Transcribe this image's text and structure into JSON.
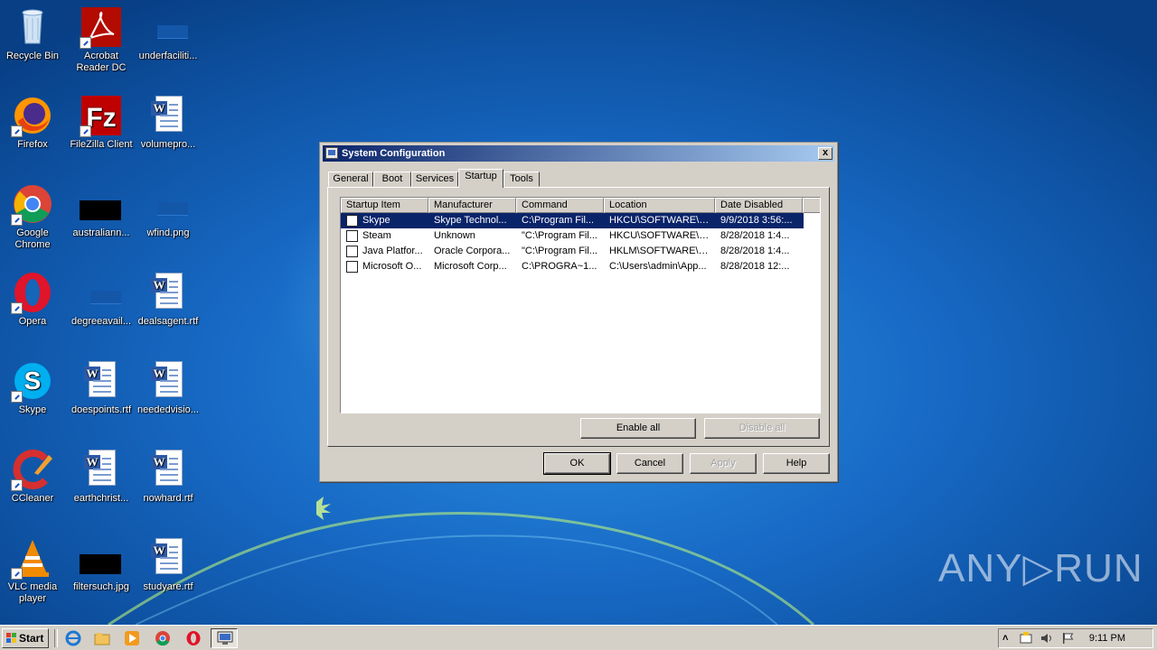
{
  "desktop": {
    "icons": [
      {
        "label": "Recycle Bin",
        "icon": "recycle-bin-icon"
      },
      {
        "label": "Acrobat Reader DC",
        "icon": "acrobat-icon"
      },
      {
        "label": "underfaciliti...",
        "icon": "image-file-icon"
      },
      {
        "label": "Firefox",
        "icon": "firefox-icon"
      },
      {
        "label": "FileZilla Client",
        "icon": "filezilla-icon"
      },
      {
        "label": "volumepro...",
        "icon": "word-document-icon"
      },
      {
        "label": "Google Chrome",
        "icon": "chrome-icon"
      },
      {
        "label": "australiann...",
        "icon": "image-file-icon"
      },
      {
        "label": "wfind.png",
        "icon": "image-file-icon"
      },
      {
        "label": "Opera",
        "icon": "opera-icon"
      },
      {
        "label": "degreeavail...",
        "icon": "image-file-icon"
      },
      {
        "label": "dealsagent.rtf",
        "icon": "word-document-icon"
      },
      {
        "label": "Skype",
        "icon": "skype-icon"
      },
      {
        "label": "doespoints.rtf",
        "icon": "word-document-icon"
      },
      {
        "label": "neededvisio...",
        "icon": "word-document-icon"
      },
      {
        "label": "CCleaner",
        "icon": "ccleaner-icon"
      },
      {
        "label": "earthchrist...",
        "icon": "word-document-icon"
      },
      {
        "label": "nowhard.rtf",
        "icon": "word-document-icon"
      },
      {
        "label": "VLC media player",
        "icon": "vlc-icon"
      },
      {
        "label": "filtersuch.jpg",
        "icon": "image-file-icon"
      },
      {
        "label": "studyare.rtf",
        "icon": "word-document-icon"
      }
    ]
  },
  "dialog": {
    "title": "System Configuration",
    "close_label": "x",
    "tabs": [
      {
        "label": "General"
      },
      {
        "label": "Boot"
      },
      {
        "label": "Services"
      },
      {
        "label": "Startup"
      },
      {
        "label": "Tools"
      }
    ],
    "active_tab": "Startup",
    "columns": [
      "Startup Item",
      "Manufacturer",
      "Command",
      "Location",
      "Date Disabled"
    ],
    "rows": [
      {
        "checked": false,
        "selected": true,
        "cells": [
          "Skype",
          "Skype Technol...",
          "C:\\Program Fil...",
          "HKCU\\SOFTWARE\\M...",
          "9/9/2018 3:56:..."
        ]
      },
      {
        "checked": false,
        "selected": false,
        "cells": [
          "Steam",
          "Unknown",
          "\"C:\\Program Fil...",
          "HKCU\\SOFTWARE\\M...",
          "8/28/2018 1:4..."
        ]
      },
      {
        "checked": false,
        "selected": false,
        "cells": [
          "Java Platfor...",
          "Oracle Corpora...",
          "\"C:\\Program Fil...",
          "HKLM\\SOFTWARE\\M...",
          "8/28/2018 1:4..."
        ]
      },
      {
        "checked": false,
        "selected": false,
        "cells": [
          "Microsoft O...",
          "Microsoft Corp...",
          "C:\\PROGRA~1...",
          "C:\\Users\\admin\\App...",
          "8/28/2018 12:..."
        ]
      }
    ],
    "enable_all": "Enable all",
    "disable_all": "Disable all",
    "ok": "OK",
    "cancel": "Cancel",
    "apply": "Apply",
    "help": "Help"
  },
  "taskbar": {
    "start_label": "Start",
    "clock": "9:11 PM",
    "tray_expand": "˄"
  },
  "watermark": "ANY▷RUN"
}
